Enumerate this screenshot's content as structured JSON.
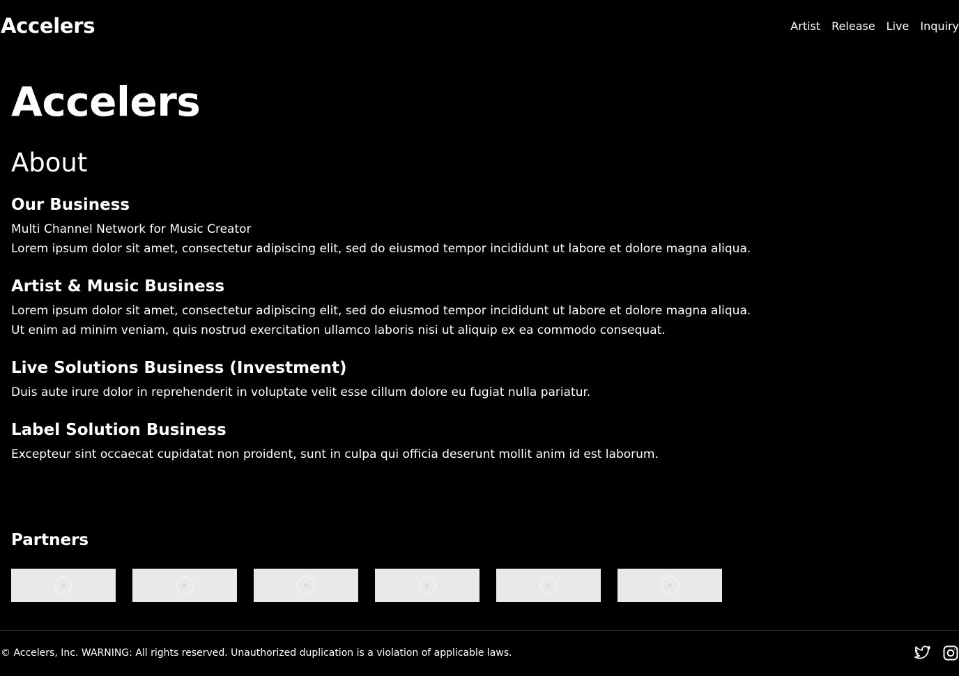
{
  "header": {
    "brand": "Accelers",
    "nav": [
      "Artist",
      "Release",
      "Live",
      "Inquiry"
    ]
  },
  "main": {
    "title": "Accelers",
    "section_title": "About",
    "blocks": [
      {
        "heading": "Our Business",
        "lines": [
          "Multi Channel Network for Music Creator",
          "Lorem ipsum dolor sit amet, consectetur adipiscing elit, sed do eiusmod tempor incididunt ut labore et dolore magna aliqua."
        ]
      },
      {
        "heading": "Artist & Music Business",
        "lines": [
          "Lorem ipsum dolor sit amet, consectetur adipiscing elit, sed do eiusmod tempor incididunt ut labore et dolore magna aliqua.",
          "Ut enim ad minim veniam, quis nostrud exercitation ullamco laboris nisi ut aliquip ex ea commodo consequat."
        ]
      },
      {
        "heading": "Live Solutions Business (Investment)",
        "lines": [
          "Duis aute irure dolor in reprehenderit in voluptate velit esse cillum dolore eu fugiat nulla pariatur."
        ]
      },
      {
        "heading": "Label Solution Business",
        "lines": [
          "Excepteur sint occaecat cupidatat non proident, sunt in culpa qui officia deserunt mollit anim id est laborum."
        ]
      }
    ]
  },
  "partners": {
    "title": "Partners",
    "logo_count": 6,
    "tile_color": "#e9e9e9"
  },
  "footer": {
    "copyright": "© Accelers, Inc. WARNING: All rights reserved. Unauthorized duplication is a violation of applicable laws.",
    "social_icons": [
      "twitter-icon",
      "instagram-icon"
    ]
  },
  "colors": {
    "background": "#000000",
    "text": "#ffffff",
    "divider": "#2a2a33"
  }
}
